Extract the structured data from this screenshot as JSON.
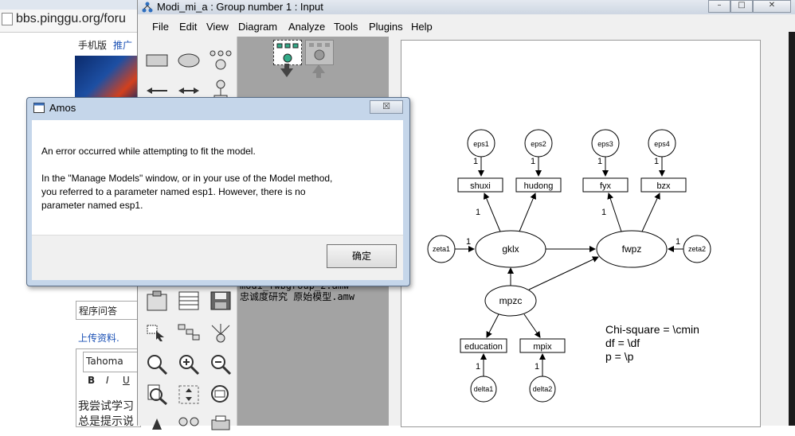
{
  "browser": {
    "url": "bbs.pinggu.org/foru",
    "nav_mobile": "手机版",
    "nav_promo": "推广",
    "post_title": "程序问答",
    "upload_link": "上传资料.",
    "font_select": "Tahoma",
    "fmt_bold": "B",
    "fmt_italic": "I",
    "fmt_underline": "U",
    "body_line1": "我尝试学习",
    "body_line2": "总是提示说"
  },
  "amos": {
    "title": "Modi_mi_a : Group number 1 : Input",
    "menu": [
      "File",
      "Edit",
      "View",
      "Diagram",
      "Analyze",
      "Tools",
      "Plugins",
      "Help"
    ],
    "files": [
      "modi_fwbgroup_2.amw",
      "忠诚度研究 原始模型.amw"
    ],
    "diagram": {
      "latent": [
        "gklx",
        "fwpz",
        "mpzc"
      ],
      "observed": [
        "shuxi",
        "hudong",
        "fyx",
        "bzx",
        "education",
        "mpix"
      ],
      "errors": [
        "eps1",
        "eps2",
        "eps3",
        "eps4",
        "zeta1",
        "zeta2",
        "delta1",
        "delta2"
      ],
      "ones": "1",
      "stats": [
        "Chi-square = \\cmin",
        "df = \\df",
        "p = \\p"
      ]
    }
  },
  "dialog": {
    "title": "Amos",
    "close": "☒",
    "line1": "An error occurred while attempting to fit the model.",
    "line2": "In the \"Manage Models\" window, or in your use of the Model method,",
    "line3": "you referred to a parameter named esp1. However, there is no",
    "line4": "parameter named esp1.",
    "ok": "确定"
  }
}
